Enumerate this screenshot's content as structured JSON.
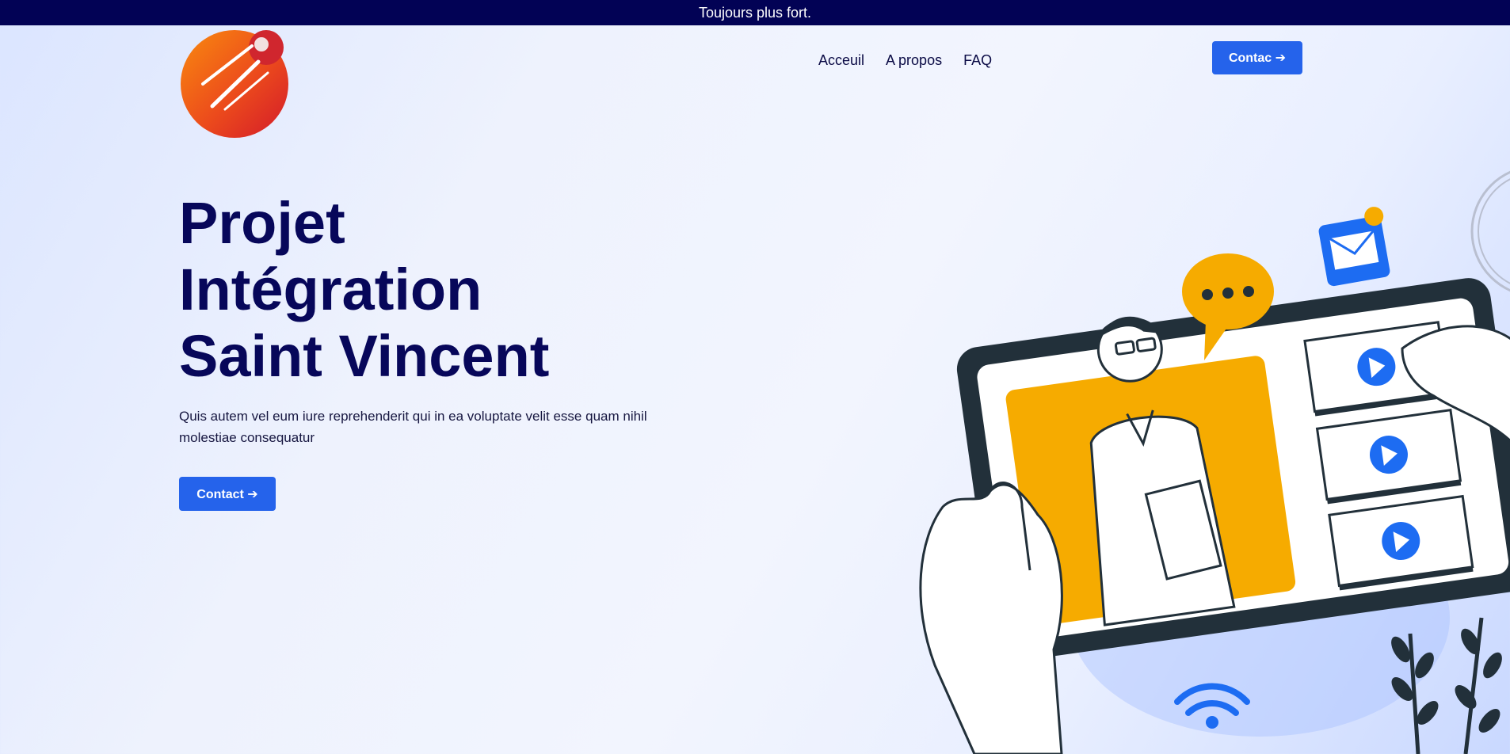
{
  "topbar": {
    "text": "Toujours plus fort."
  },
  "nav": {
    "items": [
      {
        "label": "Acceuil"
      },
      {
        "label": "A propos"
      },
      {
        "label": "FAQ"
      }
    ],
    "cta_label": "Contac ➔"
  },
  "hero": {
    "title_lines": [
      "Projet",
      "Intégration",
      "Saint Vincent"
    ],
    "description": "Quis autem vel eum iure reprehenderit qui in ea voluptate velit esse quam nihil molestiae consequatur",
    "cta_label": "Contact ➔"
  },
  "colors": {
    "topbar_bg": "#020255",
    "accent": "#2563eb",
    "title": "#07075a",
    "illustration_yellow": "#f6ab00"
  },
  "icons": [
    "logo-icon",
    "email-icon",
    "chat-bubble-icon",
    "play-icon",
    "wifi-icon",
    "plant-icon"
  ]
}
